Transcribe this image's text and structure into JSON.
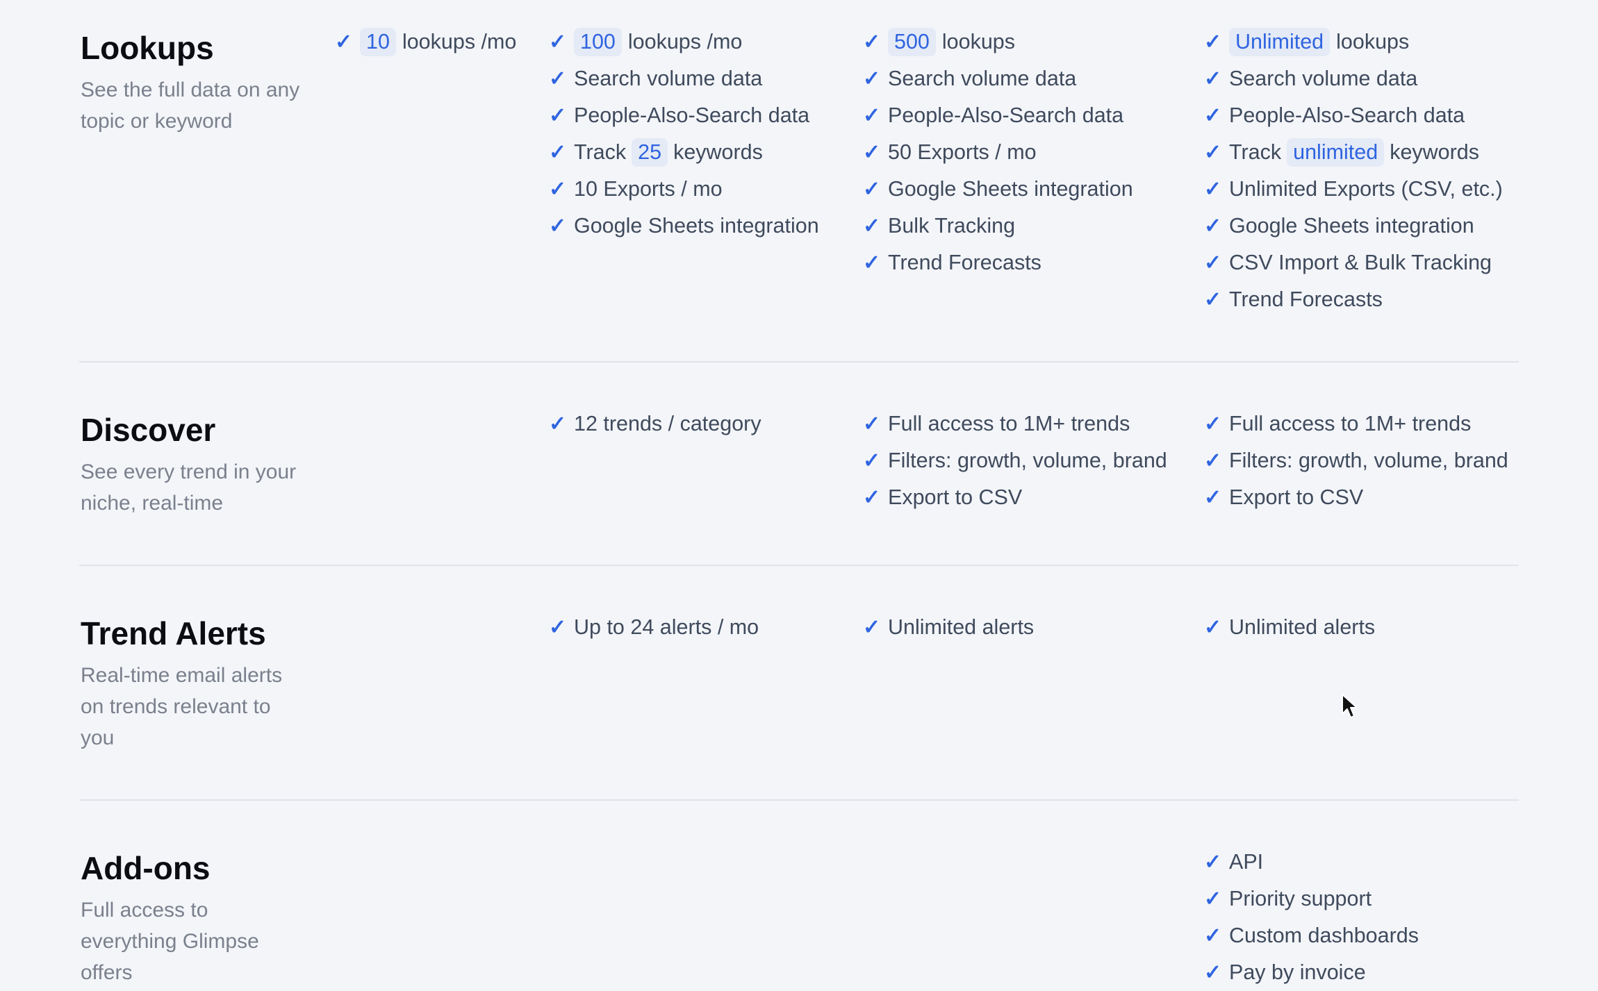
{
  "sections": [
    {
      "title": "Lookups",
      "description": "See the full data on any topic or keyword",
      "tiers": [
        [
          {
            "pre": "",
            "hl": "10",
            "post": "lookups /mo"
          }
        ],
        [
          {
            "pre": "",
            "hl": "100",
            "post": "lookups /mo"
          },
          {
            "pre": "Search volume data",
            "hl": "",
            "post": ""
          },
          {
            "pre": "People-Also-Search data",
            "hl": "",
            "post": ""
          },
          {
            "pre": "Track",
            "hl": "25",
            "post": "keywords"
          },
          {
            "pre": "10 Exports / mo",
            "hl": "",
            "post": ""
          },
          {
            "pre": "Google Sheets integration",
            "hl": "",
            "post": ""
          }
        ],
        [
          {
            "pre": "",
            "hl": "500",
            "post": "lookups"
          },
          {
            "pre": "Search volume data",
            "hl": "",
            "post": ""
          },
          {
            "pre": "People-Also-Search data",
            "hl": "",
            "post": ""
          },
          {
            "pre": "50 Exports / mo",
            "hl": "",
            "post": ""
          },
          {
            "pre": "Google Sheets integration",
            "hl": "",
            "post": ""
          },
          {
            "pre": "Bulk Tracking",
            "hl": "",
            "post": ""
          },
          {
            "pre": "Trend Forecasts",
            "hl": "",
            "post": ""
          }
        ],
        [
          {
            "pre": "",
            "hl": "Unlimited",
            "post": "lookups"
          },
          {
            "pre": "Search volume data",
            "hl": "",
            "post": ""
          },
          {
            "pre": "People-Also-Search data",
            "hl": "",
            "post": ""
          },
          {
            "pre": "Track",
            "hl": "unlimited",
            "post": "keywords"
          },
          {
            "pre": "Unlimited Exports (CSV, etc.)",
            "hl": "",
            "post": ""
          },
          {
            "pre": "Google Sheets integration",
            "hl": "",
            "post": ""
          },
          {
            "pre": "CSV Import & Bulk Tracking",
            "hl": "",
            "post": ""
          },
          {
            "pre": "Trend Forecasts",
            "hl": "",
            "post": ""
          }
        ]
      ]
    },
    {
      "title": "Discover",
      "description": "See every trend in your niche, real-time",
      "tiers": [
        [],
        [
          {
            "pre": "12 trends / category",
            "hl": "",
            "post": ""
          }
        ],
        [
          {
            "pre": "Full access to 1M+ trends",
            "hl": "",
            "post": ""
          },
          {
            "pre": "Filters: growth, volume, brand",
            "hl": "",
            "post": ""
          },
          {
            "pre": "Export to CSV",
            "hl": "",
            "post": ""
          }
        ],
        [
          {
            "pre": "Full access to 1M+ trends",
            "hl": "",
            "post": ""
          },
          {
            "pre": "Filters: growth, volume, brand",
            "hl": "",
            "post": ""
          },
          {
            "pre": "Export to CSV",
            "hl": "",
            "post": ""
          }
        ]
      ]
    },
    {
      "title": "Trend Alerts",
      "description": "Real-time email alerts on trends relevant to you",
      "tiers": [
        [],
        [
          {
            "pre": "Up to 24 alerts / mo",
            "hl": "",
            "post": ""
          }
        ],
        [
          {
            "pre": "Unlimited alerts",
            "hl": "",
            "post": ""
          }
        ],
        [
          {
            "pre": "Unlimited alerts",
            "hl": "",
            "post": ""
          }
        ]
      ]
    },
    {
      "title": "Add-ons",
      "description": "Full access to everything Glimpse offers",
      "tiers": [
        [],
        [],
        [],
        [
          {
            "pre": "API",
            "hl": "",
            "post": ""
          },
          {
            "pre": "Priority support",
            "hl": "",
            "post": ""
          },
          {
            "pre": "Custom dashboards",
            "hl": "",
            "post": ""
          },
          {
            "pre": "Pay by invoice",
            "hl": "",
            "post": ""
          }
        ]
      ]
    }
  ],
  "colors": {
    "background": "#f3f5f9",
    "accent": "#2f64e0",
    "highlight_bg": "#e4eaf6",
    "heading": "#0b0d12",
    "body_text": "#3f4a5c",
    "muted_text": "#7a808c"
  },
  "icons": {
    "feature_check": "check-icon",
    "pointer": "mouse-cursor-icon"
  }
}
